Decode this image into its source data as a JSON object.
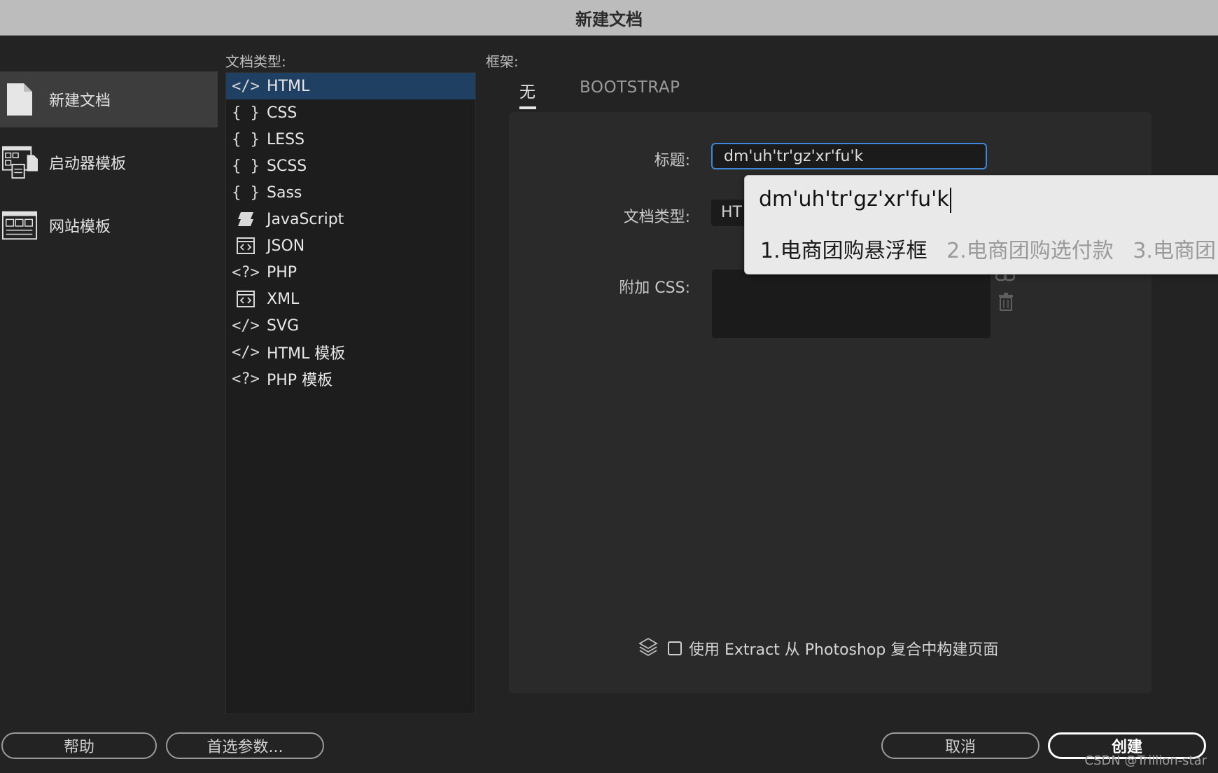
{
  "window": {
    "title": "新建文档"
  },
  "sidebar": {
    "items": [
      {
        "label": "新建文档",
        "icon": "document-icon",
        "selected": true
      },
      {
        "label": "启动器模板",
        "icon": "starter-template-icon",
        "selected": false
      },
      {
        "label": "网站模板",
        "icon": "site-template-icon",
        "selected": false
      }
    ]
  },
  "doctype_section": {
    "label": "文档类型:",
    "items": [
      {
        "icon": "</>",
        "label": "HTML",
        "selected": true
      },
      {
        "icon": "{ }",
        "label": "CSS"
      },
      {
        "icon": "{ }",
        "label": "LESS"
      },
      {
        "icon": "{ }",
        "label": "SCSS"
      },
      {
        "icon": "{ }",
        "label": "Sass"
      },
      {
        "icon": "js",
        "label": "JavaScript"
      },
      {
        "icon": "box",
        "label": "JSON"
      },
      {
        "icon": "<?>",
        "label": "PHP"
      },
      {
        "icon": "box",
        "label": "XML"
      },
      {
        "icon": "</>",
        "label": "SVG"
      },
      {
        "icon": "</>",
        "label": "HTML 模板"
      },
      {
        "icon": "<?>",
        "label": "PHP 模板"
      }
    ]
  },
  "framework": {
    "label": "框架:",
    "tabs": [
      {
        "label": "无",
        "active": true
      },
      {
        "label": "BOOTSTRAP",
        "active": false
      }
    ]
  },
  "form": {
    "title_label": "标题:",
    "title_value": "dm'uh'tr'gz'xr'fu'k",
    "doctype_label": "文档类型:",
    "doctype_value": "HT",
    "css_label": "附加 CSS:"
  },
  "ime": {
    "composition": "dm'uh'tr'gz'xr'fu'k",
    "candidates": [
      "1.电商团购悬浮框",
      "2.电商团购选付款",
      "3.电商团"
    ]
  },
  "extract": {
    "label": "使用 Extract 从 Photoshop 复合中构建页面"
  },
  "buttons": {
    "help": "帮助",
    "prefs": "首选参数...",
    "cancel": "取消",
    "create": "创建"
  },
  "watermark": "CSDN @Trillion-star",
  "colors": {
    "accent": "#3e86d8",
    "selection": "#1f3f63",
    "background": "#232323"
  }
}
